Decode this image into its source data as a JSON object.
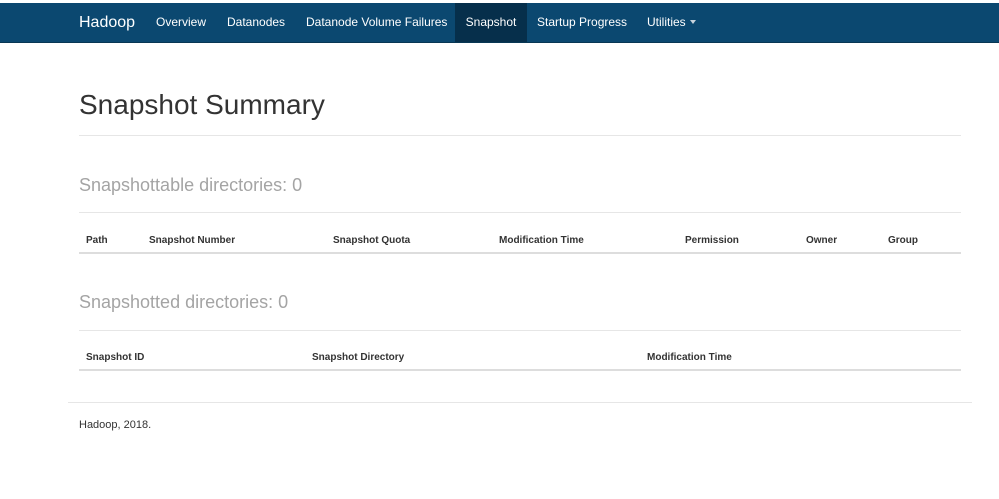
{
  "navbar": {
    "brand": "Hadoop",
    "items": [
      {
        "label": "Overview"
      },
      {
        "label": "Datanodes"
      },
      {
        "label": "Datanode Volume Failures"
      },
      {
        "label": "Snapshot",
        "active": true
      },
      {
        "label": "Startup Progress"
      },
      {
        "label": "Utilities",
        "dropdown": true
      }
    ]
  },
  "page": {
    "title": "Snapshot Summary"
  },
  "snapshottable": {
    "title": "Snapshottable directories: 0",
    "columns": [
      "Path",
      "Snapshot Number",
      "Snapshot Quota",
      "Modification Time",
      "Permission",
      "Owner",
      "Group"
    ],
    "rows": []
  },
  "snapshotted": {
    "title": "Snapshotted directories: 0",
    "columns": [
      "Snapshot ID",
      "Snapshot Directory",
      "Modification Time"
    ],
    "rows": []
  },
  "footer": {
    "text": "Hadoop, 2018."
  },
  "colors": {
    "navbar": "#0b4870",
    "navbar_active": "#062f4b",
    "section_title": "#a4a4a4"
  }
}
